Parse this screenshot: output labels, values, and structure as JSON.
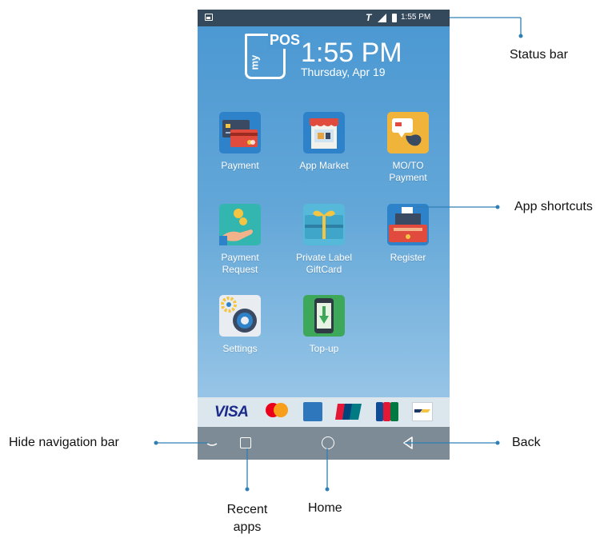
{
  "status_bar": {
    "carrier_glyph": "T",
    "time": "1:55 PM"
  },
  "home": {
    "logo_top": "POS",
    "logo_side": "my",
    "clock": "1:55 PM",
    "date": "Thursday, Apr 19"
  },
  "apps": [
    {
      "label": "Payment",
      "icon": "payment-card-icon"
    },
    {
      "label": "App Market",
      "icon": "app-market-icon"
    },
    {
      "label": "MO/TO\nPayment",
      "icon": "moto-phone-icon"
    },
    {
      "label": "Payment\nRequest",
      "icon": "payment-request-icon"
    },
    {
      "label": "Private Label\nGiftCard",
      "icon": "gift-card-icon"
    },
    {
      "label": "Register",
      "icon": "cash-register-icon"
    },
    {
      "label": "Settings",
      "icon": "gear-icon"
    },
    {
      "label": "Top-up",
      "icon": "top-up-phone-icon"
    }
  ],
  "brands": {
    "visa": "VISA",
    "mastercard": "mastercard",
    "amex": "AMERICAN EXPRESS",
    "unionpay": "UnionPay",
    "jcb": "JCB",
    "bancontact": "Bancontact"
  },
  "callouts": {
    "status_bar": "Status bar",
    "app_shortcuts": "App shortcuts",
    "hide_nav": "Hide navigation bar",
    "back": "Back",
    "recent": "Recent\napps",
    "home": "Home"
  },
  "colors": {
    "status_bar_bg": "#34495c",
    "screen_top": "#4a97d2",
    "screen_bottom": "#a9cfea",
    "nav_bar_bg": "#7d8b96",
    "callout_line": "#2f7fb5"
  }
}
